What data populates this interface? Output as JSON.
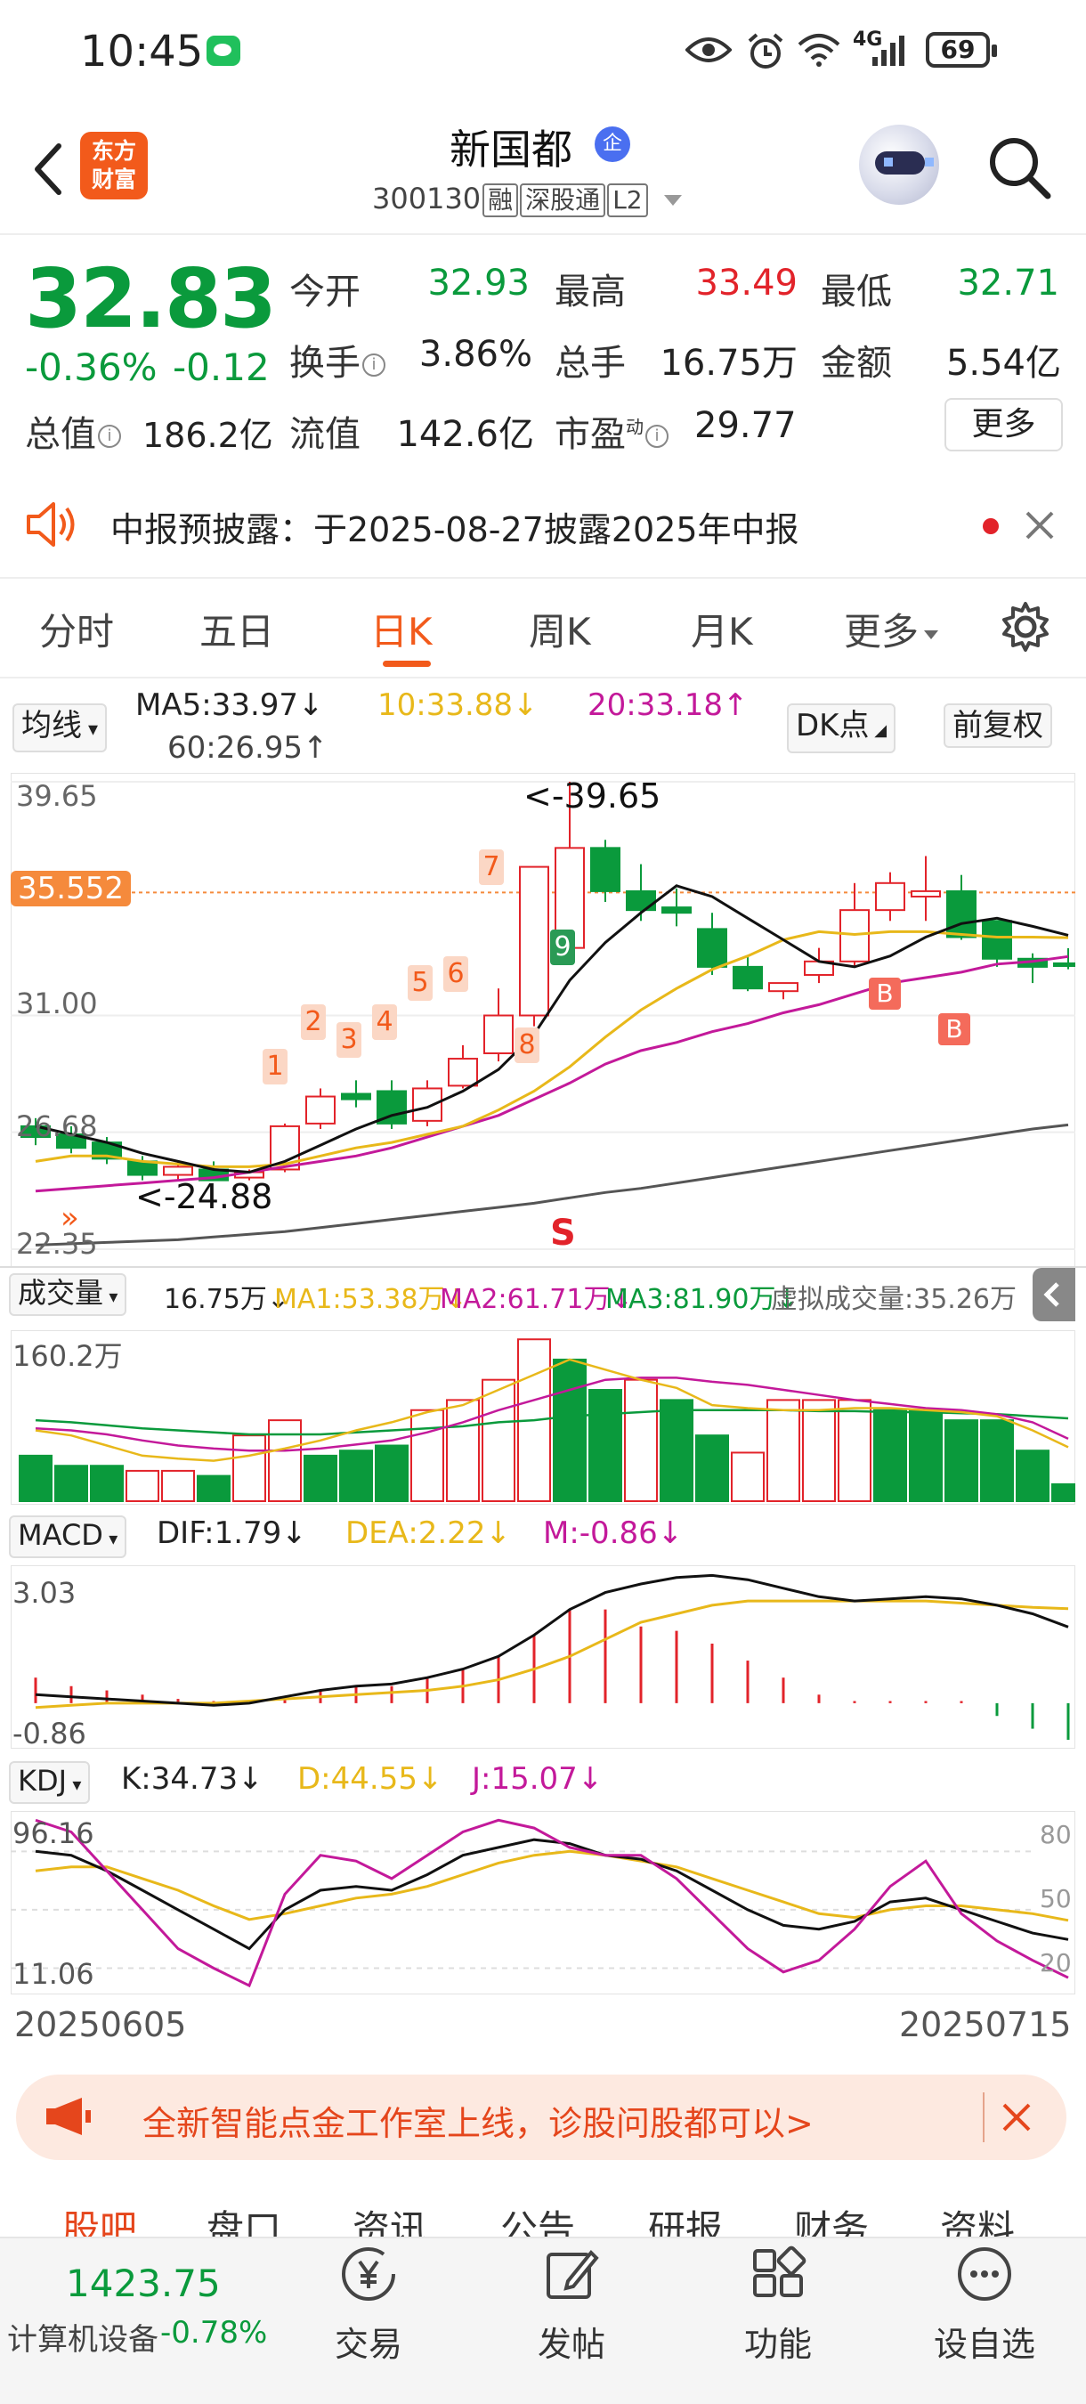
{
  "status_bar": {
    "time": "10:45",
    "network": "4G",
    "battery": "69"
  },
  "header": {
    "stock_name": "新国都",
    "badge": "企",
    "code": "300130",
    "tags": [
      "融",
      "深股通",
      "L2"
    ],
    "logo_text": [
      "东方",
      "财富"
    ]
  },
  "quote": {
    "price": "32.83",
    "change_pct": "-0.36%",
    "change_amt": "-0.12",
    "open_label": "今开",
    "open": "32.93",
    "high_label": "最高",
    "high": "33.49",
    "low_label": "最低",
    "low": "32.71",
    "turnover_label": "换手",
    "turnover": "3.86%",
    "volume_label": "总手",
    "volume": "16.75万",
    "amount_label": "金额",
    "amount": "5.54亿",
    "mktcap_label": "总值",
    "mktcap": "186.2亿",
    "float_label": "流值",
    "float_cap": "142.6亿",
    "pe_label": "市盈",
    "pe_sup": "动",
    "pe": "29.77",
    "more_label": "更多",
    "info_icon": "i"
  },
  "notice": {
    "text": "中报预披露：于2025-08-27披露2025年中报"
  },
  "period_tabs": [
    {
      "label": "分时"
    },
    {
      "label": "五日"
    },
    {
      "label": "日K"
    },
    {
      "label": "周K"
    },
    {
      "label": "月K"
    },
    {
      "label": "更多"
    }
  ],
  "ma_bar": {
    "selector": "均线",
    "ma5": "MA5:33.97↓",
    "ma10": "10:33.88↓",
    "ma20": "20:33.18↑",
    "ma60": "60:26.95↑",
    "dk_button": "DK点",
    "restore_button": "前复权"
  },
  "kline_axis": {
    "top": "39.65",
    "current": "35.552",
    "mid": "31.00",
    "lower": "26.68",
    "bottom": "22.35",
    "high_marker": "<-39.65",
    "low_marker": "<-24.88",
    "sell_marker": "S",
    "buy_marker": "B",
    "seq_labels": [
      "1",
      "2",
      "3",
      "4",
      "5",
      "6",
      "7",
      "8",
      "9"
    ]
  },
  "volume_bar": {
    "selector": "成交量",
    "vol": "16.75万↓",
    "ma1": "MA1:53.38万↓",
    "ma2": "MA2:61.71万↓",
    "ma3": "MA3:81.90万↓",
    "virtual": "虚拟成交量:35.26万",
    "axis_top": "160.2万"
  },
  "macd_bar": {
    "selector": "MACD",
    "dif": "DIF:1.79↓",
    "dea": "DEA:2.22↓",
    "m": "M:-0.86↓",
    "axis_top": "3.03",
    "axis_bottom": "-0.86"
  },
  "kdj_bar": {
    "selector": "KDJ",
    "k": "K:34.73↓",
    "d": "D:44.55↓",
    "j": "J:15.07↓",
    "axis_top": "96.16",
    "axis_bottom": "11.06",
    "r80": "80",
    "r50": "50",
    "r20": "20"
  },
  "date_axis": {
    "start": "20250605",
    "end": "20250715"
  },
  "banner": {
    "text": "全新智能点金工作室上线，诊股问股都可以>"
  },
  "sub_tabs": [
    {
      "label": "股吧"
    },
    {
      "label": "盘口"
    },
    {
      "label": "资讯"
    },
    {
      "label": "公告"
    },
    {
      "label": "研报"
    },
    {
      "label": "财务"
    },
    {
      "label": "资料"
    }
  ],
  "bottom_bar": {
    "index_value": "1423.75",
    "index_name": "计算机设备",
    "index_change": "-0.78%",
    "items": [
      {
        "label": "交易",
        "icon": "yen-icon"
      },
      {
        "label": "发帖",
        "icon": "edit-icon"
      },
      {
        "label": "功能",
        "icon": "grid-icon"
      },
      {
        "label": "设自选",
        "icon": "more-dots-icon"
      }
    ]
  },
  "colors": {
    "up": "#e2232a",
    "down": "#0a9a3c",
    "accent": "#f25a1b",
    "ma5": "#111111",
    "ma10": "#e8b81a",
    "ma20": "#c3199a",
    "ma60": "#555555"
  },
  "chart_data": [
    {
      "type": "candlestick",
      "title": "日K",
      "dates_range": [
        "20250605",
        "20250715"
      ],
      "ylim": [
        22.35,
        39.65
      ],
      "candles": [
        {
          "o": 26.9,
          "h": 27.2,
          "c": 26.5,
          "l": 26.2
        },
        {
          "o": 26.6,
          "h": 26.9,
          "c": 26.1,
          "l": 25.9
        },
        {
          "o": 26.3,
          "h": 26.5,
          "c": 25.7,
          "l": 25.5
        },
        {
          "o": 25.6,
          "h": 25.8,
          "c": 25.1,
          "l": 24.9
        },
        {
          "o": 25.1,
          "h": 25.6,
          "c": 25.4,
          "l": 24.9
        },
        {
          "o": 25.3,
          "h": 25.6,
          "c": 24.9,
          "l": 24.88
        },
        {
          "o": 25.0,
          "h": 25.3,
          "c": 25.2,
          "l": 24.9
        },
        {
          "o": 25.3,
          "h": 27.0,
          "c": 26.9,
          "l": 25.2
        },
        {
          "o": 27.0,
          "h": 28.3,
          "c": 28.0,
          "l": 26.8
        },
        {
          "o": 28.1,
          "h": 28.6,
          "c": 27.9,
          "l": 27.6
        },
        {
          "o": 28.2,
          "h": 28.6,
          "c": 27.0,
          "l": 26.8
        },
        {
          "o": 27.1,
          "h": 28.6,
          "c": 28.3,
          "l": 26.9
        },
        {
          "o": 28.4,
          "h": 29.9,
          "c": 29.4,
          "l": 28.3
        },
        {
          "o": 29.6,
          "h": 32.0,
          "c": 31.0,
          "l": 29.3
        },
        {
          "o": 31.0,
          "h": 36.5,
          "c": 36.5,
          "l": 30.6
        },
        {
          "o": 33.5,
          "h": 39.65,
          "c": 37.2,
          "l": 33.1
        },
        {
          "o": 37.2,
          "h": 37.5,
          "c": 35.6,
          "l": 35.2
        },
        {
          "o": 35.6,
          "h": 36.6,
          "c": 34.9,
          "l": 34.5
        },
        {
          "o": 35.0,
          "h": 35.7,
          "c": 34.8,
          "l": 34.3
        },
        {
          "o": 34.2,
          "h": 34.8,
          "c": 32.8,
          "l": 32.5
        },
        {
          "o": 32.8,
          "h": 33.2,
          "c": 32.0,
          "l": 31.9
        },
        {
          "o": 31.9,
          "h": 32.2,
          "c": 32.2,
          "l": 31.6
        },
        {
          "o": 32.5,
          "h": 33.5,
          "c": 33.0,
          "l": 32.2
        },
        {
          "o": 33.0,
          "h": 35.9,
          "c": 34.9,
          "l": 32.8
        },
        {
          "o": 34.9,
          "h": 36.3,
          "c": 35.9,
          "l": 34.5
        },
        {
          "o": 35.4,
          "h": 36.9,
          "c": 35.6,
          "l": 34.5
        },
        {
          "o": 35.6,
          "h": 36.2,
          "c": 33.9,
          "l": 33.8
        },
        {
          "o": 34.5,
          "h": 34.5,
          "c": 33.1,
          "l": 32.8
        },
        {
          "o": 33.1,
          "h": 33.3,
          "c": 32.8,
          "l": 32.2
        },
        {
          "o": 32.93,
          "h": 33.49,
          "c": 32.83,
          "l": 32.71
        }
      ],
      "ma5": [
        26.9,
        26.6,
        26.3,
        25.9,
        25.6,
        25.3,
        25.2,
        25.6,
        26.2,
        26.8,
        27.3,
        27.6,
        28.2,
        29.0,
        30.3,
        32.3,
        33.7,
        34.8,
        35.8,
        35.4,
        34.6,
        33.8,
        33.0,
        32.8,
        33.2,
        33.9,
        34.4,
        34.6,
        34.3,
        33.97
      ],
      "ma10": [
        25.6,
        25.8,
        25.8,
        25.6,
        25.5,
        25.4,
        25.4,
        25.5,
        25.8,
        26.1,
        26.3,
        26.6,
        26.9,
        27.5,
        28.2,
        29.1,
        30.2,
        31.2,
        32.0,
        32.7,
        33.2,
        33.8,
        34.1,
        34.0,
        34.1,
        34.1,
        34.0,
        33.9,
        33.9,
        33.88
      ],
      "ma20": [
        24.5,
        24.6,
        24.7,
        24.8,
        24.9,
        25.0,
        25.2,
        25.4,
        25.6,
        25.8,
        26.1,
        26.5,
        26.9,
        27.3,
        27.9,
        28.5,
        29.2,
        29.7,
        30.0,
        30.4,
        30.7,
        31.1,
        31.4,
        31.8,
        32.2,
        32.4,
        32.6,
        32.9,
        33.0,
        33.18
      ],
      "ma60": [
        22.5,
        22.55,
        22.6,
        22.65,
        22.7,
        22.8,
        22.9,
        23.0,
        23.15,
        23.3,
        23.45,
        23.6,
        23.75,
        23.9,
        24.05,
        24.25,
        24.45,
        24.6,
        24.8,
        25.0,
        25.2,
        25.4,
        25.6,
        25.8,
        26.0,
        26.2,
        26.4,
        26.6,
        26.8,
        26.95
      ]
    },
    {
      "type": "bar",
      "title": "成交量",
      "ylim": [
        0,
        160.2
      ],
      "volumes": [
        45,
        35,
        35,
        30,
        30,
        25,
        65,
        80,
        45,
        50,
        55,
        90,
        100,
        120,
        160,
        140,
        110,
        120,
        100,
        65,
        48,
        100,
        100,
        100,
        90,
        90,
        80,
        80,
        50,
        16.75
      ],
      "up": [
        false,
        false,
        false,
        true,
        true,
        false,
        true,
        true,
        false,
        false,
        false,
        true,
        true,
        true,
        true,
        false,
        false,
        true,
        false,
        false,
        true,
        true,
        true,
        true,
        false,
        false,
        false,
        false,
        false,
        false
      ],
      "ma1": [
        70,
        65,
        55,
        45,
        42,
        40,
        45,
        52,
        60,
        70,
        78,
        88,
        95,
        110,
        125,
        140,
        130,
        120,
        112,
        95,
        92,
        90,
        90,
        92,
        92,
        90,
        88,
        84,
        70,
        53.38
      ],
      "ma2": [
        72,
        70,
        66,
        60,
        55,
        52,
        50,
        50,
        52,
        56,
        60,
        68,
        78,
        90,
        100,
        110,
        120,
        122,
        122,
        118,
        115,
        110,
        105,
        100,
        96,
        92,
        90,
        86,
        78,
        61.71
      ],
      "ma3": [
        80,
        78,
        75,
        72,
        70,
        68,
        66,
        66,
        66,
        68,
        70,
        72,
        74,
        78,
        80,
        84,
        86,
        88,
        90,
        90,
        90,
        90,
        89,
        89,
        88,
        88,
        87,
        86,
        84,
        81.9
      ]
    },
    {
      "type": "line",
      "title": "MACD",
      "ylim": [
        -0.86,
        3.03
      ],
      "dif": [
        0.2,
        0.15,
        0.1,
        0.05,
        0.0,
        -0.05,
        0.0,
        0.15,
        0.3,
        0.4,
        0.45,
        0.6,
        0.8,
        1.1,
        1.6,
        2.2,
        2.6,
        2.8,
        2.95,
        3.0,
        2.9,
        2.7,
        2.5,
        2.4,
        2.45,
        2.5,
        2.45,
        2.3,
        2.1,
        1.79
      ],
      "dea": [
        -0.1,
        -0.05,
        0.0,
        0.0,
        0.0,
        0.0,
        0.05,
        0.1,
        0.15,
        0.2,
        0.25,
        0.3,
        0.4,
        0.55,
        0.8,
        1.1,
        1.5,
        1.9,
        2.1,
        2.3,
        2.4,
        2.4,
        2.4,
        2.4,
        2.4,
        2.4,
        2.35,
        2.3,
        2.25,
        2.22
      ],
      "m": [
        0.6,
        0.4,
        0.3,
        0.2,
        0.1,
        0.05,
        0.05,
        0.1,
        0.3,
        0.4,
        0.4,
        0.6,
        0.8,
        1.1,
        1.6,
        2.2,
        2.2,
        1.8,
        1.7,
        1.4,
        1.0,
        0.6,
        0.2,
        0.05,
        0.05,
        0.05,
        0.05,
        -0.3,
        -0.6,
        -0.86
      ]
    },
    {
      "type": "line",
      "title": "KDJ",
      "ylim": [
        11.06,
        96.16
      ],
      "k": [
        80,
        78,
        70,
        60,
        50,
        40,
        30,
        50,
        60,
        62,
        60,
        68,
        78,
        82,
        86,
        84,
        78,
        76,
        70,
        60,
        50,
        42,
        40,
        44,
        54,
        56,
        50,
        44,
        38,
        34.73
      ],
      "d": [
        70,
        72,
        72,
        66,
        60,
        52,
        45,
        48,
        52,
        56,
        58,
        62,
        68,
        74,
        78,
        80,
        78,
        75,
        72,
        66,
        60,
        54,
        48,
        46,
        50,
        52,
        52,
        50,
        48,
        44.55
      ],
      "j": [
        96,
        90,
        70,
        50,
        30,
        20,
        11,
        58,
        78,
        75,
        66,
        78,
        90,
        96,
        92,
        82,
        78,
        78,
        66,
        48,
        30,
        18,
        24,
        40,
        62,
        75,
        48,
        34,
        24,
        15.07
      ]
    }
  ]
}
